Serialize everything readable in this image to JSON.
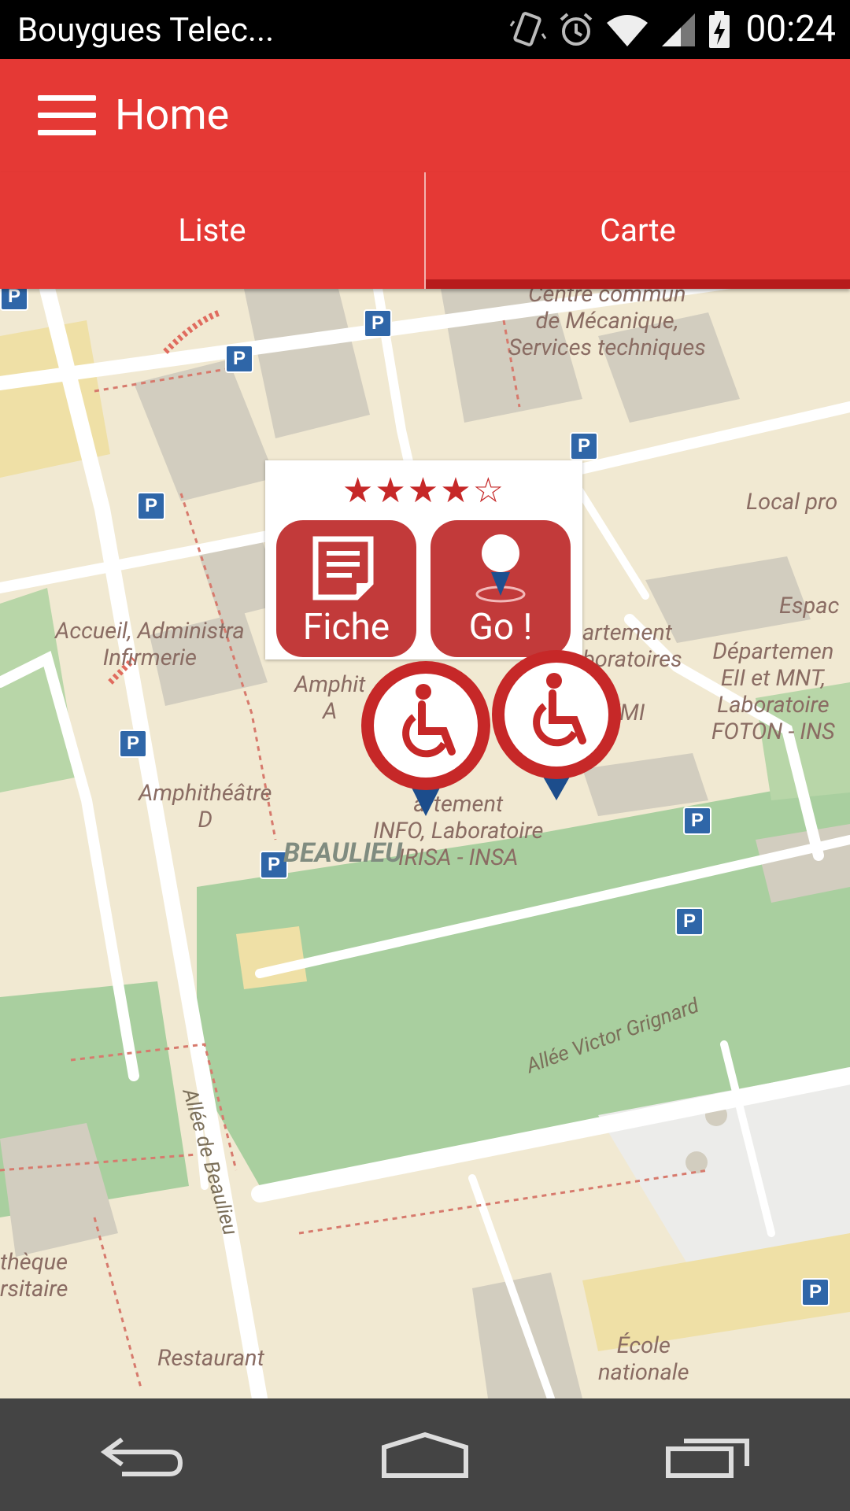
{
  "status_bar": {
    "carrier": "Bouygues Telec...",
    "time": "00:24"
  },
  "app_bar": {
    "title": "Home"
  },
  "tabs": [
    {
      "label": "Liste",
      "active": false
    },
    {
      "label": "Carte",
      "active": true
    }
  ],
  "map": {
    "labels": {
      "meca": "Centre commun\nde Mécanique,\nServices techniques",
      "local": "Local pro",
      "espace": "Espac",
      "accueil": "Accueil, Administra\nInfirmerie",
      "amphi_partial": "Amphit\nA",
      "dept_right": "artement\nboratoires\nM -\nCR/MI\nSA",
      "dept_eii": "Départemen\nEII et MNT,\nLaboratoire\nFOTON - INS",
      "amphi_d": "Amphithéâtre\nD",
      "info": "artement\nINFO, Laboratoire\nIRISA - INSA",
      "beaulieu": "BEAULIEU",
      "grignard": "Allée Victor Grignard",
      "allee_beaulieu": "Allée de Beaulieu",
      "bibli": "thèque\nrsitaire",
      "restaurant": "Restaurant",
      "ecole": "École\nnationale"
    },
    "popup": {
      "rating": 4,
      "rating_max": 5,
      "stars": "★★★★☆",
      "fiche_label": "Fiche",
      "go_label": "Go !"
    },
    "markers": [
      {
        "icon": "wheelchair-icon"
      },
      {
        "icon": "wheelchair-icon"
      }
    ]
  },
  "nav": {
    "back": "back-icon",
    "home": "home-icon",
    "recents": "recents-icon"
  }
}
